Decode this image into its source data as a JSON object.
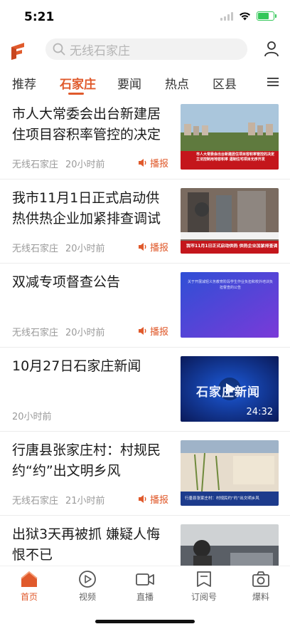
{
  "status": {
    "time": "5:21"
  },
  "search": {
    "placeholder": "无线石家庄"
  },
  "tabs": [
    "推荐",
    "石家庄",
    "要闻",
    "热点",
    "区县"
  ],
  "active_tab": "石家庄",
  "accent_color": "#e05a2c",
  "news": [
    {
      "title": "市人大常委会出台新建居住项目容积率管控的决定",
      "source": "无线石家庄",
      "time": "20小时前",
      "action": "播报",
      "thumb_caption": "市人大常委会出台新建居住项目容积率管控的决定 立法控制用地容积率 遏制住宅项目无序开发"
    },
    {
      "title": "我市11月1日正式启动供热供热企业加紧排查调试",
      "source": "无线石家庄",
      "time": "20小时前",
      "action": "播报",
      "thumb_caption": "我市11月1日正式启动供热 供热企业加紧排查调试"
    },
    {
      "title": "双减专项督查公告",
      "source": "无线石家庄",
      "time": "20小时前",
      "action": "播报",
      "thumb_caption": "关于开展减轻义务教育阶段学生作业负担和校外培训负担督查的公告"
    },
    {
      "title": "10月27日石家庄新闻",
      "source": "",
      "time": "20小时前",
      "action": "",
      "duration": "24:32",
      "thumb_caption": "石家庄新闻"
    },
    {
      "title": "行唐县张家庄村：村规民约“约”出文明乡风",
      "source": "无线石家庄",
      "time": "21小时前",
      "action": "播报",
      "thumb_caption": "行唐县张家庄村：村规民约“约”出文明乡风"
    },
    {
      "title": "出狱3天再被抓 嫌疑人悔恨不已",
      "source": "",
      "time": "",
      "action": "",
      "thumb_caption": ""
    }
  ],
  "bottom_nav": [
    {
      "label": "首页",
      "icon": "home-icon",
      "active": true
    },
    {
      "label": "视频",
      "icon": "video-play-icon",
      "active": false
    },
    {
      "label": "直播",
      "icon": "live-camera-icon",
      "active": false
    },
    {
      "label": "订阅号",
      "icon": "bookmark-icon",
      "active": false
    },
    {
      "label": "爆料",
      "icon": "camera-icon",
      "active": false
    }
  ]
}
